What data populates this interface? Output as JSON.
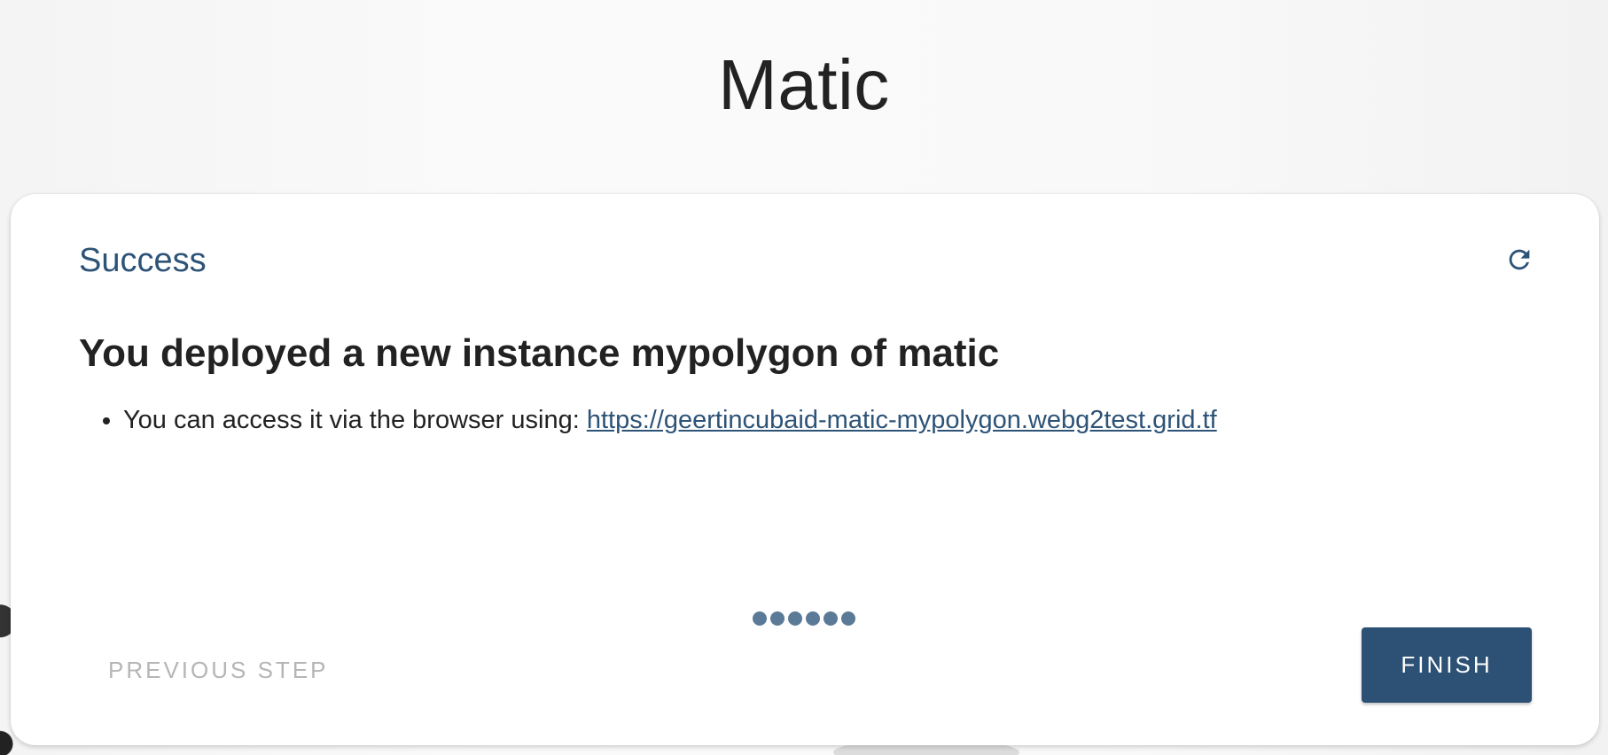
{
  "page": {
    "title": "Matic"
  },
  "card": {
    "header": "Success",
    "refresh_icon": "refresh-icon",
    "heading": "You deployed a new instance mypolygon of matic",
    "list": [
      {
        "prefix": "You can access it via the browser using: ",
        "link_text": "https://geertincubaid-matic-mypolygon.webg2test.grid.tf"
      }
    ],
    "step_count": 6
  },
  "footer": {
    "previous_label": "PREVIOUS STEP",
    "finish_label": "FINISH"
  },
  "colors": {
    "accent": "#2c5175",
    "link": "#2d5377",
    "dots": "#5a7a97",
    "disabled_text": "#b5b5b5"
  }
}
